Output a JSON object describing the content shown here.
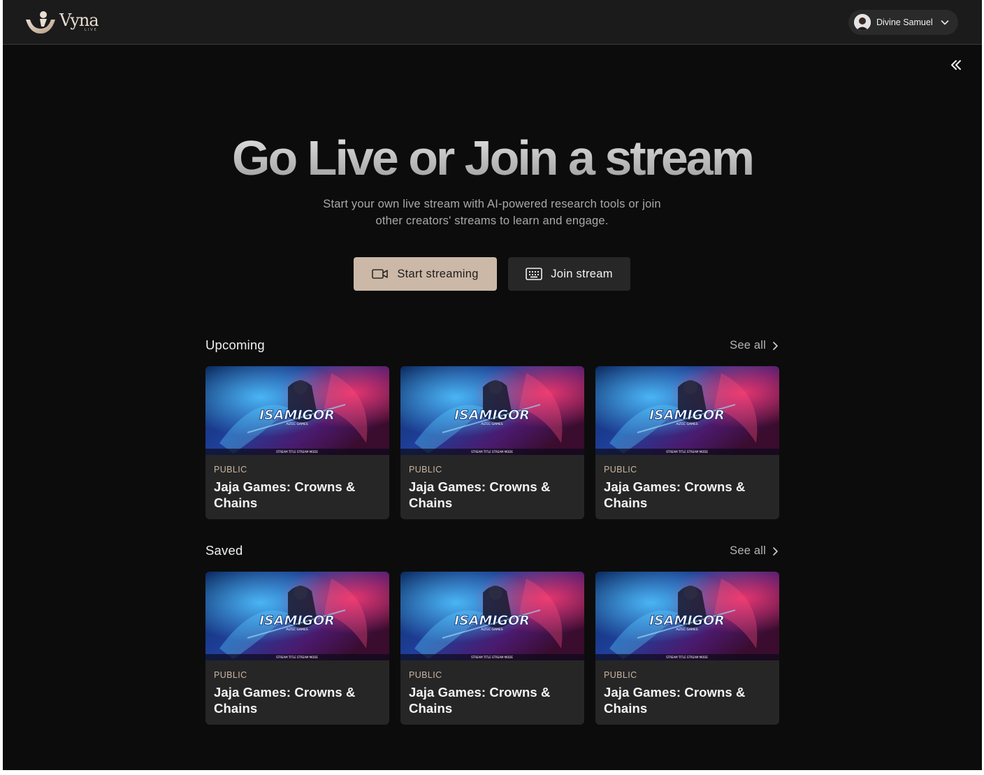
{
  "header": {
    "logo": {
      "word": "Vyna",
      "sub": "LIVE"
    },
    "user": {
      "name": "Divine Samuel"
    }
  },
  "hero": {
    "title": "Go Live or Join a stream",
    "subtitle": "Start your own live stream with AI-powered research tools or join other creators' streams to learn and engage.",
    "start_label": "Start streaming",
    "join_label": "Join stream"
  },
  "sections": [
    {
      "title": "Upcoming",
      "see_all": "See all",
      "cards": [
        {
          "badge": "PUBLIC",
          "title": "Jaja Games: Crowns & Chains",
          "thumb_logo": "ISAMIGOR",
          "thumb_tag": "ALTEC GAMES",
          "thumb_caption": "STREAM TITLE STREAM MODE"
        },
        {
          "badge": "PUBLIC",
          "title": "Jaja Games: Crowns & Chains",
          "thumb_logo": "ISAMIGOR",
          "thumb_tag": "ALTEC GAMES",
          "thumb_caption": "STREAM TITLE STREAM MODE"
        },
        {
          "badge": "PUBLIC",
          "title": "Jaja Games: Crowns & Chains",
          "thumb_logo": "ISAMIGOR",
          "thumb_tag": "ALTEC GAMES",
          "thumb_caption": "STREAM TITLE STREAM MODE"
        }
      ]
    },
    {
      "title": "Saved",
      "see_all": "See all",
      "cards": [
        {
          "badge": "PUBLIC",
          "title": "Jaja Games: Crowns & Chains",
          "thumb_logo": "ISAMIGOR",
          "thumb_tag": "ALTEC GAMES",
          "thumb_caption": "STREAM TITLE STREAM MODE"
        },
        {
          "badge": "PUBLIC",
          "title": "Jaja Games: Crowns & Chains",
          "thumb_logo": "ISAMIGOR",
          "thumb_tag": "ALTEC GAMES",
          "thumb_caption": "STREAM TITLE STREAM MODE"
        },
        {
          "badge": "PUBLIC",
          "title": "Jaja Games: Crowns & Chains",
          "thumb_logo": "ISAMIGOR",
          "thumb_tag": "ALTEC GAMES",
          "thumb_caption": "STREAM TITLE STREAM MODE"
        }
      ]
    }
  ],
  "icons": {
    "collapse": "double-chevron-left-icon",
    "user_menu": "chevron-down-icon",
    "start": "video-camera-icon",
    "join": "keyboard-icon",
    "see_all": "chevron-right-icon"
  },
  "colors": {
    "background": "#0c0c0c",
    "topbar": "#1b1b1b",
    "accent": "#ccb8a6",
    "card": "#262626"
  }
}
